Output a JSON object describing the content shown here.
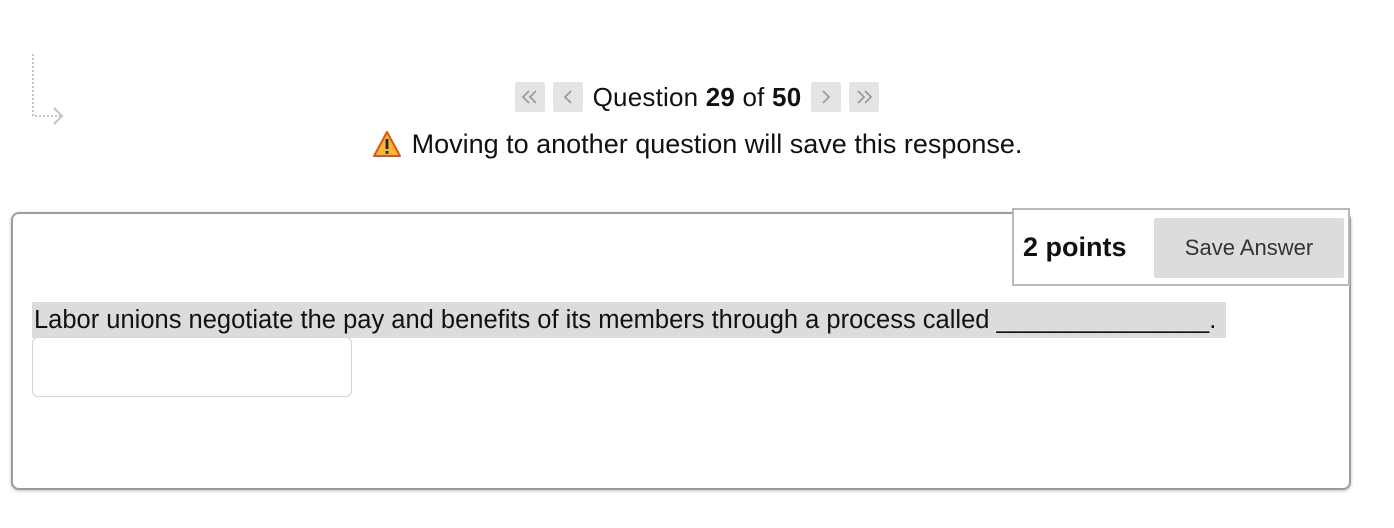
{
  "corner_icon": "corner-down-right-arrow-icon",
  "nav": {
    "first_icon": "double-chevron-left-icon",
    "prev_icon": "chevron-left-icon",
    "next_icon": "chevron-right-icon",
    "last_icon": "double-chevron-right-icon",
    "question_word": "Question",
    "current": "29",
    "of_word": "of",
    "total": "50"
  },
  "warning": {
    "icon": "warning-triangle-icon",
    "text": "Moving to another question will save this response.",
    "icon_color": "#f5a623"
  },
  "question": {
    "points_label": "2 points",
    "save_label": "Save Answer",
    "prompt": "Labor unions negotiate the pay and benefits of its members through a process called _______________.",
    "answer_value": ""
  },
  "colors": {
    "button_bg": "#e4e4e4",
    "highlight_bg": "#dcdcdc",
    "card_border": "#9c9c9c"
  }
}
